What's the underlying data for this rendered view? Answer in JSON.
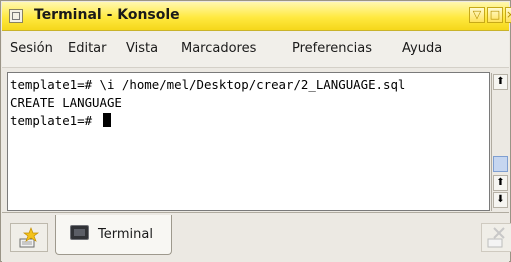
{
  "window": {
    "title": "Terminal - Konsole",
    "title_buttons": {
      "minimize": "▽",
      "maximize": "□",
      "close": "×"
    }
  },
  "menubar": {
    "items": [
      {
        "label": "Sesión"
      },
      {
        "label": "Editar"
      },
      {
        "label": "Vista"
      },
      {
        "label": "Marcadores"
      },
      {
        "label": "Preferencias"
      },
      {
        "label": "Ayuda"
      }
    ]
  },
  "terminal": {
    "lines": [
      "template1=# \\i /home/mel/Desktop/crear/2_LANGUAGE.sql",
      "CREATE LANGUAGE",
      "template1=# "
    ]
  },
  "scrollbar": {
    "up_arrow": "⬆",
    "page_up": "⬆",
    "page_down": "⬇"
  },
  "tabs": {
    "items": [
      {
        "label": "Terminal"
      }
    ]
  },
  "icons": {
    "window_menu": "window-menu-icon",
    "new_session": "new-session-icon",
    "terminal_tab": "terminal-icon",
    "close_session": "close-session-icon"
  },
  "colors": {
    "titlebar": "#ffe940",
    "scroll_thumb": "#c6d6f0"
  }
}
